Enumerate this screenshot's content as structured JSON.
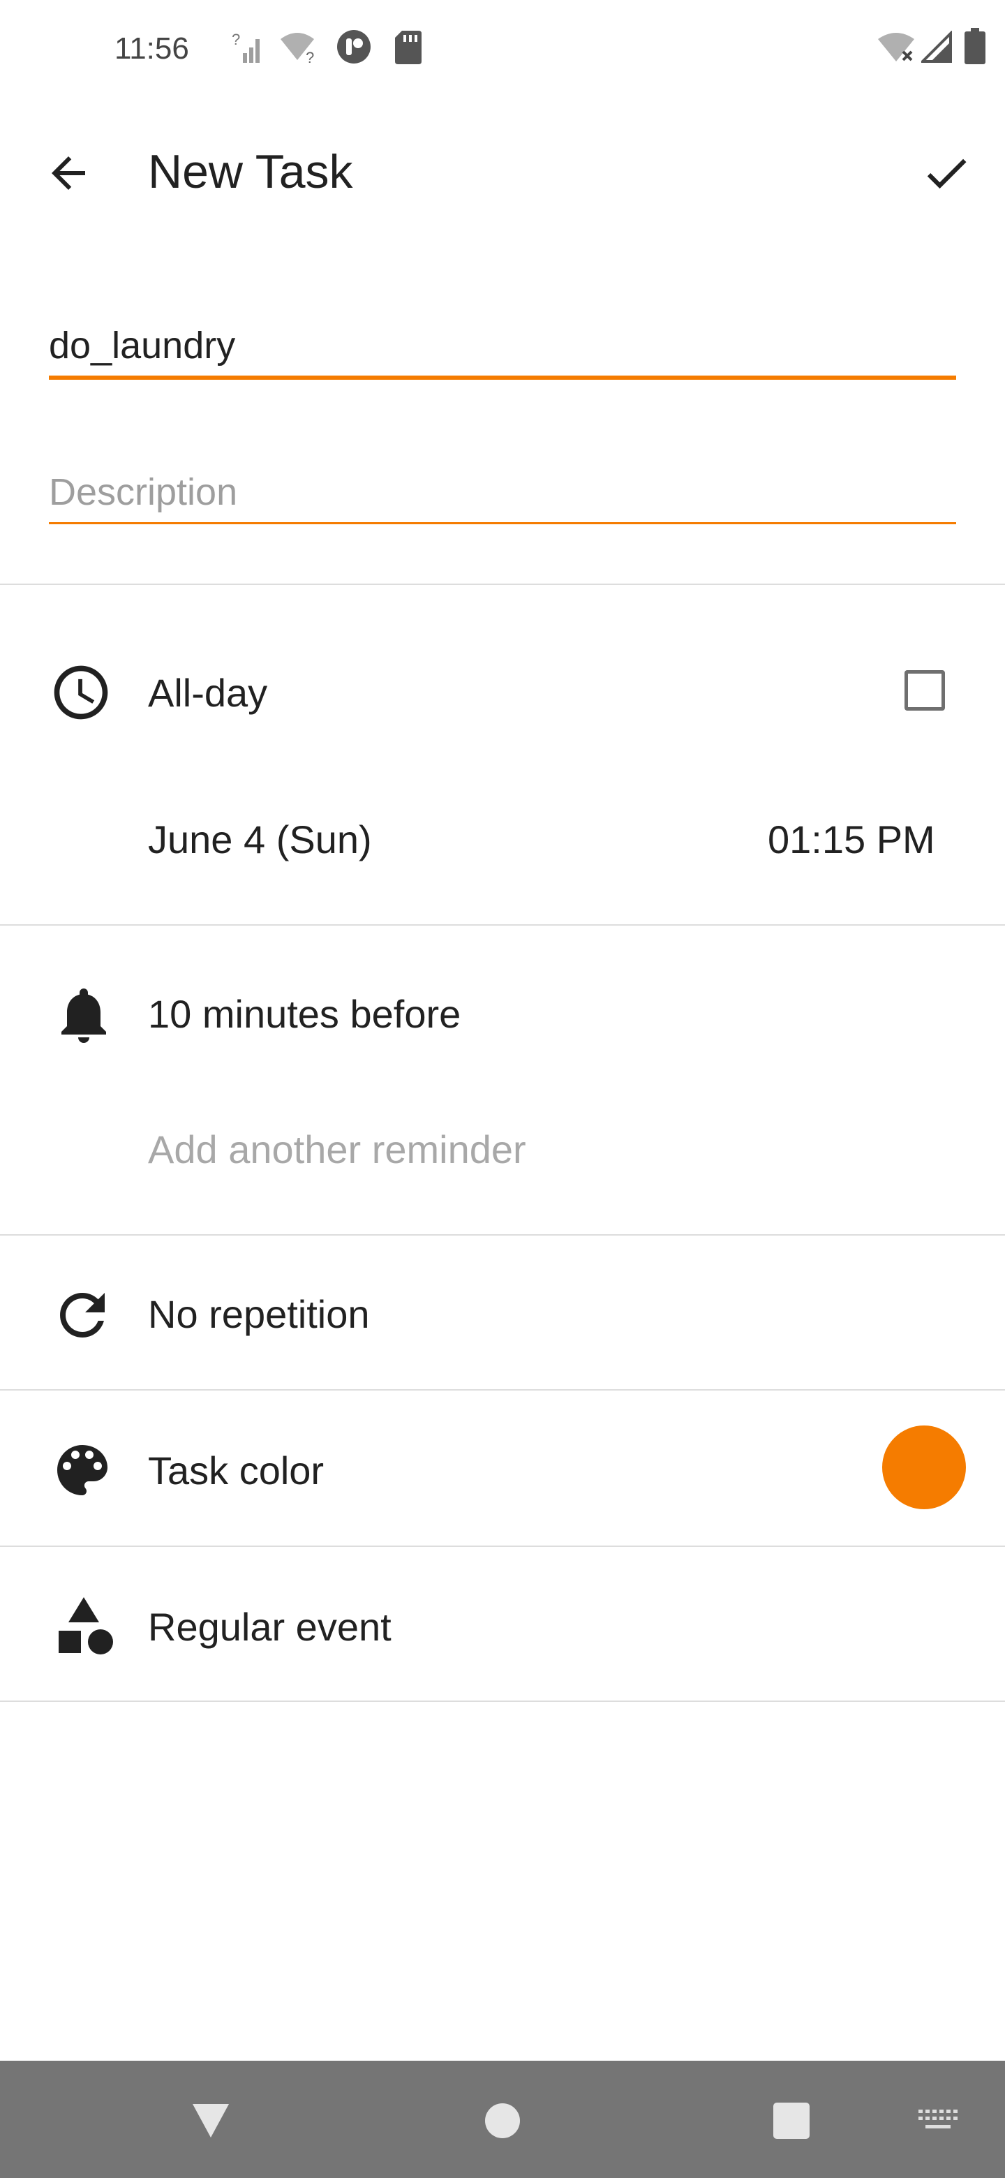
{
  "status_bar": {
    "time": "11:56"
  },
  "toolbar": {
    "title": "New Task",
    "back_icon": "arrow-back-icon",
    "save_icon": "check-icon"
  },
  "form": {
    "title_value": "do_laundry",
    "description_placeholder": "Description"
  },
  "schedule": {
    "all_day_label": "All-day",
    "all_day_checked": false,
    "date": "June 4 (Sun)",
    "time": "01:15 PM"
  },
  "reminders": {
    "first": "10 minutes before",
    "add_another": "Add another reminder"
  },
  "repetition": {
    "label": "No repetition"
  },
  "task_color": {
    "label": "Task color",
    "color": "#F57C00"
  },
  "event_type": {
    "label": "Regular event"
  },
  "theme": {
    "accent": "#F57C00"
  }
}
